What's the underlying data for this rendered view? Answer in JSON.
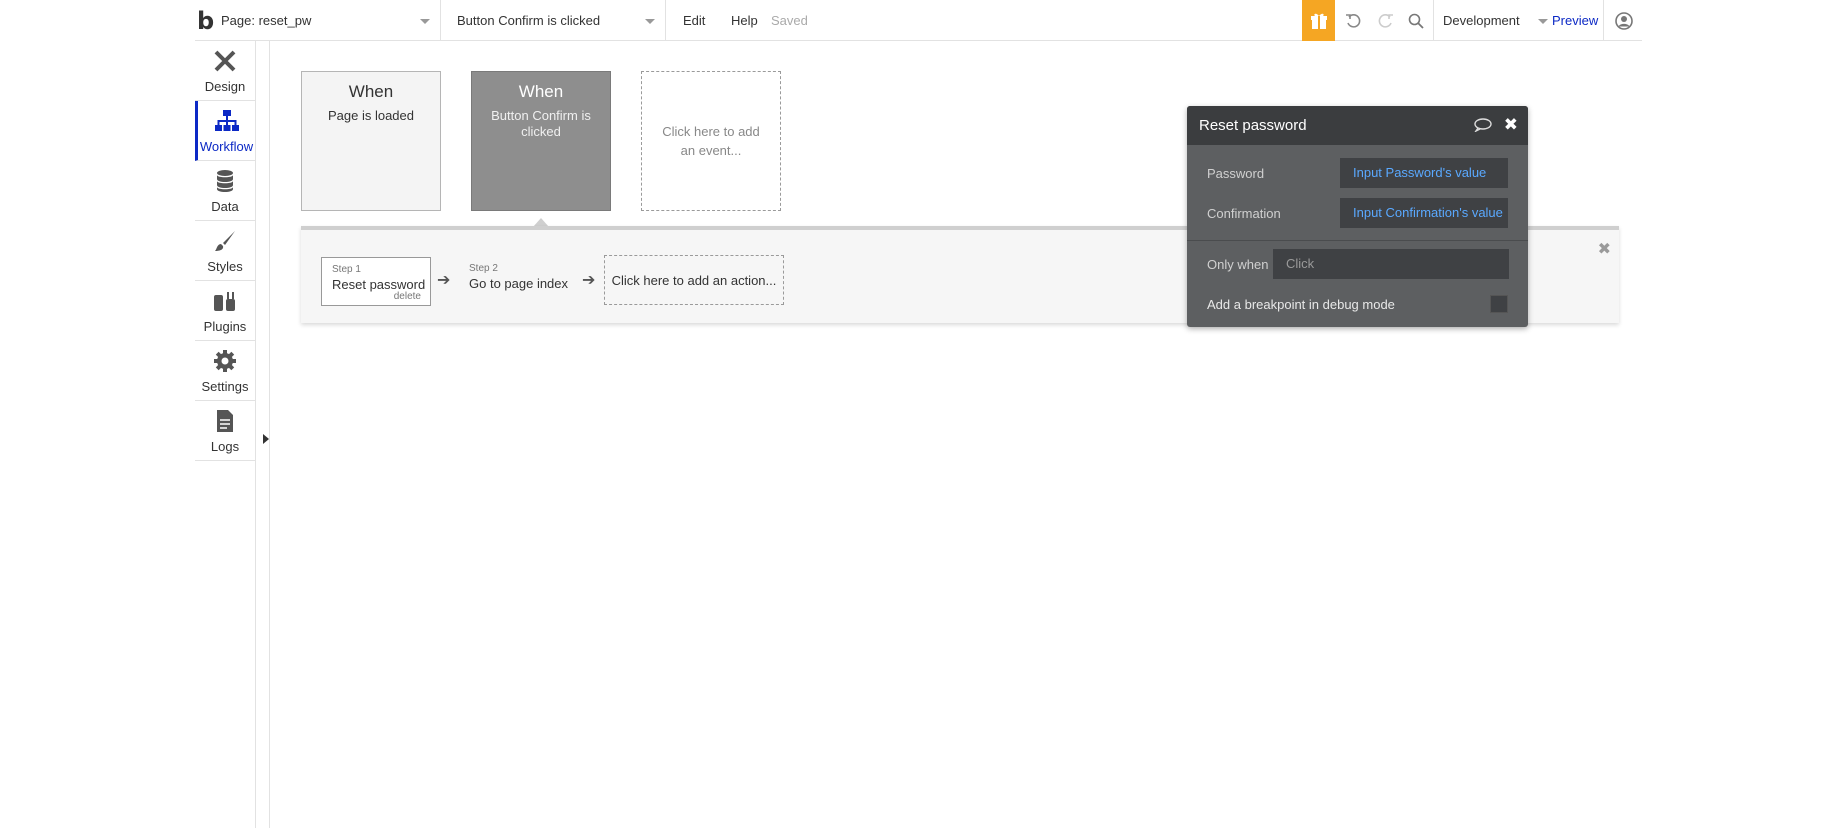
{
  "topbar": {
    "logo": "b",
    "page_label": "Page: reset_pw",
    "event_label": "Button Confirm is clicked",
    "menu_edit": "Edit",
    "menu_help": "Help",
    "saved": "Saved",
    "environment": "Development",
    "preview": "Preview",
    "accent_color": "#f5a623",
    "link_color": "#0c29c5"
  },
  "sidebar": {
    "items": [
      {
        "label": "Design",
        "icon": "design-icon"
      },
      {
        "label": "Workflow",
        "icon": "workflow-icon",
        "active": true
      },
      {
        "label": "Data",
        "icon": "database-icon"
      },
      {
        "label": "Styles",
        "icon": "brush-icon"
      },
      {
        "label": "Plugins",
        "icon": "plug-icon"
      },
      {
        "label": "Settings",
        "icon": "gear-icon"
      },
      {
        "label": "Logs",
        "icon": "document-icon"
      }
    ]
  },
  "events": [
    {
      "when": "When",
      "condition": "Page is loaded"
    },
    {
      "when": "When",
      "condition": "Button Confirm is clicked"
    }
  ],
  "add_event": "Click here to add an event...",
  "steps": [
    {
      "label": "Step 1",
      "name": "Reset password",
      "delete": "delete"
    },
    {
      "label": "Step 2",
      "name": "Go to page index"
    }
  ],
  "add_action": "Click here to add an action...",
  "editor": {
    "title": "Reset password",
    "fields": [
      {
        "key": "Password",
        "value": "Input Password's value"
      },
      {
        "key": "Confirmation",
        "value": "Input Confirmation's value"
      }
    ],
    "only_when_label": "Only when",
    "only_when_placeholder": "Click",
    "breakpoint_label": "Add a breakpoint in debug mode"
  }
}
